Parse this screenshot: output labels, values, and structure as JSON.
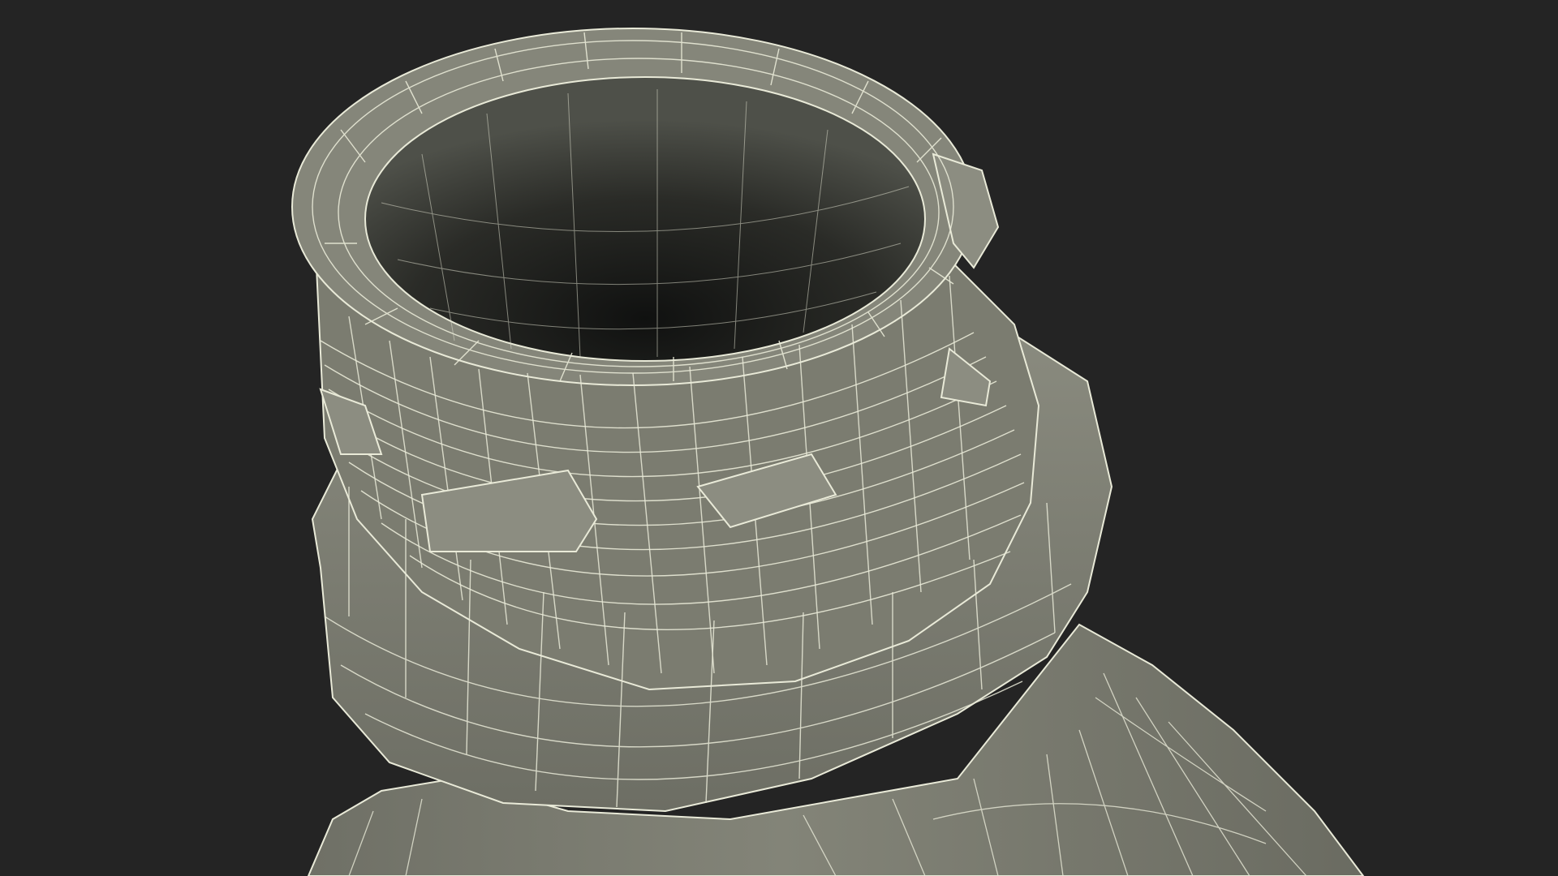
{
  "scene": {
    "subject": "wireframe-bottle-neck",
    "colors": {
      "background": "#242424",
      "surface": "#7a7b6f",
      "surface_light": "#8b8c80",
      "surface_dark": "#5f6057",
      "interior_top": "#4e5049",
      "interior_bottom": "#131412",
      "wire": "#e9ead8"
    }
  }
}
